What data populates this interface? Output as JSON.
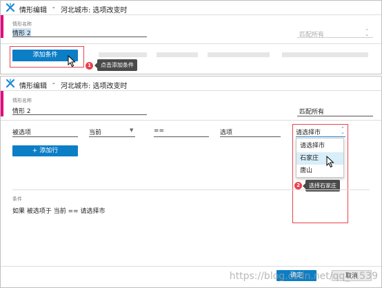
{
  "window1": {
    "title": "情形编辑",
    "separator": "-",
    "subtitle": "河北城市: 选项改变时",
    "name_label": "情形名称",
    "name_value": "情形 2",
    "match_select": "匹配所有",
    "add_condition_button": "添加条件",
    "callout1": {
      "number": "1",
      "text": "点击添加条件"
    }
  },
  "window2": {
    "title": "情形编辑",
    "separator": "-",
    "subtitle": "河北城市: 选项改变时",
    "name_label": "情形名称",
    "name_value": "情形 2",
    "match_select": "匹配所有",
    "row": {
      "field": "被选项",
      "comparator_target": "当前",
      "operator": "==",
      "value_type": "选项",
      "value_select": "请选择市"
    },
    "dropdown_options": [
      "请选择市",
      "石家庄",
      "唐山"
    ],
    "add_row_button": "+ 添加行",
    "conditions_label": "条件",
    "condition_text": "如果 被选项于 当前 == 请选择市",
    "callout2": {
      "number": "2",
      "text": "选择石家庄"
    },
    "ok_button": "确定",
    "cancel_button": "取消"
  },
  "watermark": "https://blog.csdn.net/qq_…539",
  "colors": {
    "accent": "#e4007f",
    "primary": "#0b7ec6",
    "annotation": "#e8414b"
  }
}
